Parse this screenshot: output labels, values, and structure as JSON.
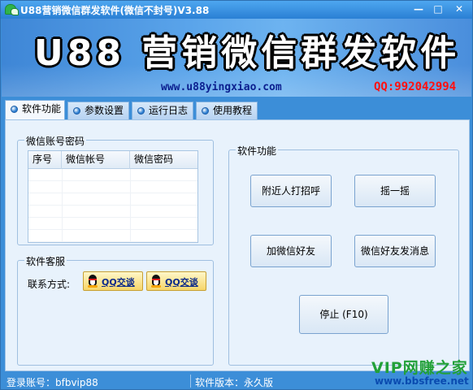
{
  "window": {
    "title": "U88营销微信群发软件(微信不封号)V3.88",
    "min_glyph": "—",
    "max_glyph": "□",
    "close_glyph": "✕"
  },
  "banner": {
    "title": "U88 营销微信群发软件",
    "url": "www.u88yingxiao.com",
    "qq": "QQ:992042994"
  },
  "tabs": [
    {
      "label": "软件功能",
      "active": true
    },
    {
      "label": "参数设置",
      "active": false
    },
    {
      "label": "运行日志",
      "active": false
    },
    {
      "label": "使用教程",
      "active": false
    }
  ],
  "accounts_group": {
    "title": "微信账号密码",
    "columns": [
      "序号",
      "微信帐号",
      "微信密码"
    ],
    "rows": []
  },
  "service_group": {
    "title": "软件客服",
    "contact_label": "联系方式:",
    "qq_buttons": [
      "QQ交谈",
      "QQ交谈"
    ]
  },
  "functions_group": {
    "title": "软件功能",
    "buttons": {
      "nearby_greet": "附近人打招呼",
      "shake": "摇一摇",
      "add_friends": "加微信好友",
      "message_friends": "微信好友发消息",
      "stop": "停止 (F10)"
    }
  },
  "statusbar": {
    "login": "登录账号：bfbvip88",
    "version": "软件版本：永久版"
  },
  "watermark": {
    "top": "VIP网赚之家",
    "bottom": "www.bbsfree.net"
  },
  "colors": {
    "window_blue": "#3c8ed8",
    "panel_bg": "#e8f2fc",
    "qq_red": "#ff1010",
    "url_blue": "#0b1f8f",
    "watermark_green": "#22a038"
  },
  "icons": {
    "app": "wechat-icon",
    "tab_marker": "radio-dot-icon",
    "qq": "qq-penguin-icon"
  }
}
